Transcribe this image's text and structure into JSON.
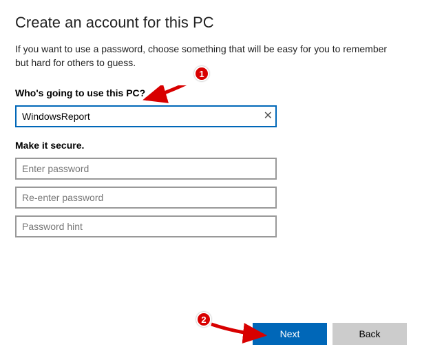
{
  "title": "Create an account for this PC",
  "description": "If you want to use a password, choose something that will be easy for you to remember but hard for others to guess.",
  "section_user_label": "Who's going to use this PC?",
  "username": {
    "value": "WindowsReport"
  },
  "section_secure_label": "Make it secure.",
  "password": {
    "placeholder": "Enter password"
  },
  "password_confirm": {
    "placeholder": "Re-enter password"
  },
  "password_hint": {
    "placeholder": "Password hint"
  },
  "buttons": {
    "next": "Next",
    "back": "Back"
  },
  "annotations": {
    "1": "1",
    "2": "2"
  }
}
